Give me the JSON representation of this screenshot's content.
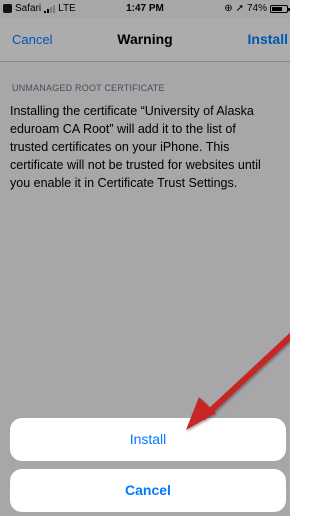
{
  "status_bar": {
    "back_app": "Safari",
    "network": "LTE",
    "time": "1:47 PM",
    "battery": "74%",
    "battery_level": 0.74
  },
  "nav": {
    "left_label": "Cancel",
    "title": "Warning",
    "right_label": "Install"
  },
  "content": {
    "section_header": "UNMANAGED ROOT CERTIFICATE",
    "body_lines": [
      "Installing the certificate “University of Alaska",
      "eduroam CA Root” will add it to the list of",
      "trusted certificates on your iPhone. This",
      "certificate will not be trusted for websites until",
      "you enable it in Certificate Trust Settings."
    ]
  },
  "action_sheet": {
    "install_label": "Install",
    "cancel_label": "Cancel"
  },
  "colors": {
    "accent": "#007aff",
    "annotation_arrow": "#c62828"
  }
}
